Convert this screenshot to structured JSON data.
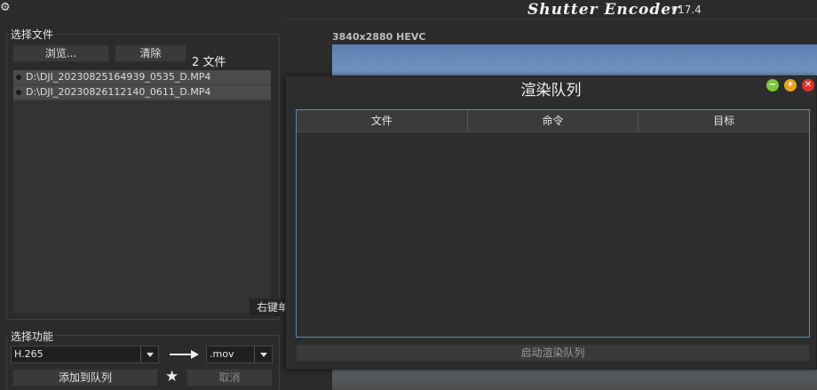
{
  "app": {
    "title": "Shutter Encoder",
    "version": "v17.4"
  },
  "file_panel": {
    "group_label": "选择文件",
    "browse_label": "浏览...",
    "clear_label": "清除",
    "file_count": "2 文件",
    "files": [
      "D:\\DJI_20230825164939_0535_D.MP4",
      "D:\\DJI_20230826112140_0611_D.MP4"
    ],
    "right_click_hint": "右键单"
  },
  "function_panel": {
    "group_label": "选择功能",
    "function_value": "H.265",
    "container_value": ".mov",
    "add_to_queue_label": "添加到队列",
    "cancel_label": "取消"
  },
  "preview": {
    "info": "3840x2880 HEVC"
  },
  "render_queue": {
    "title": "渲染队列",
    "columns": [
      "文件",
      "命令",
      "目标"
    ],
    "start_label": "启动渲染队列",
    "window_colors": {
      "minimize": "#7cc63a",
      "maximize": "#e6a51c",
      "close": "#e0312d"
    }
  }
}
